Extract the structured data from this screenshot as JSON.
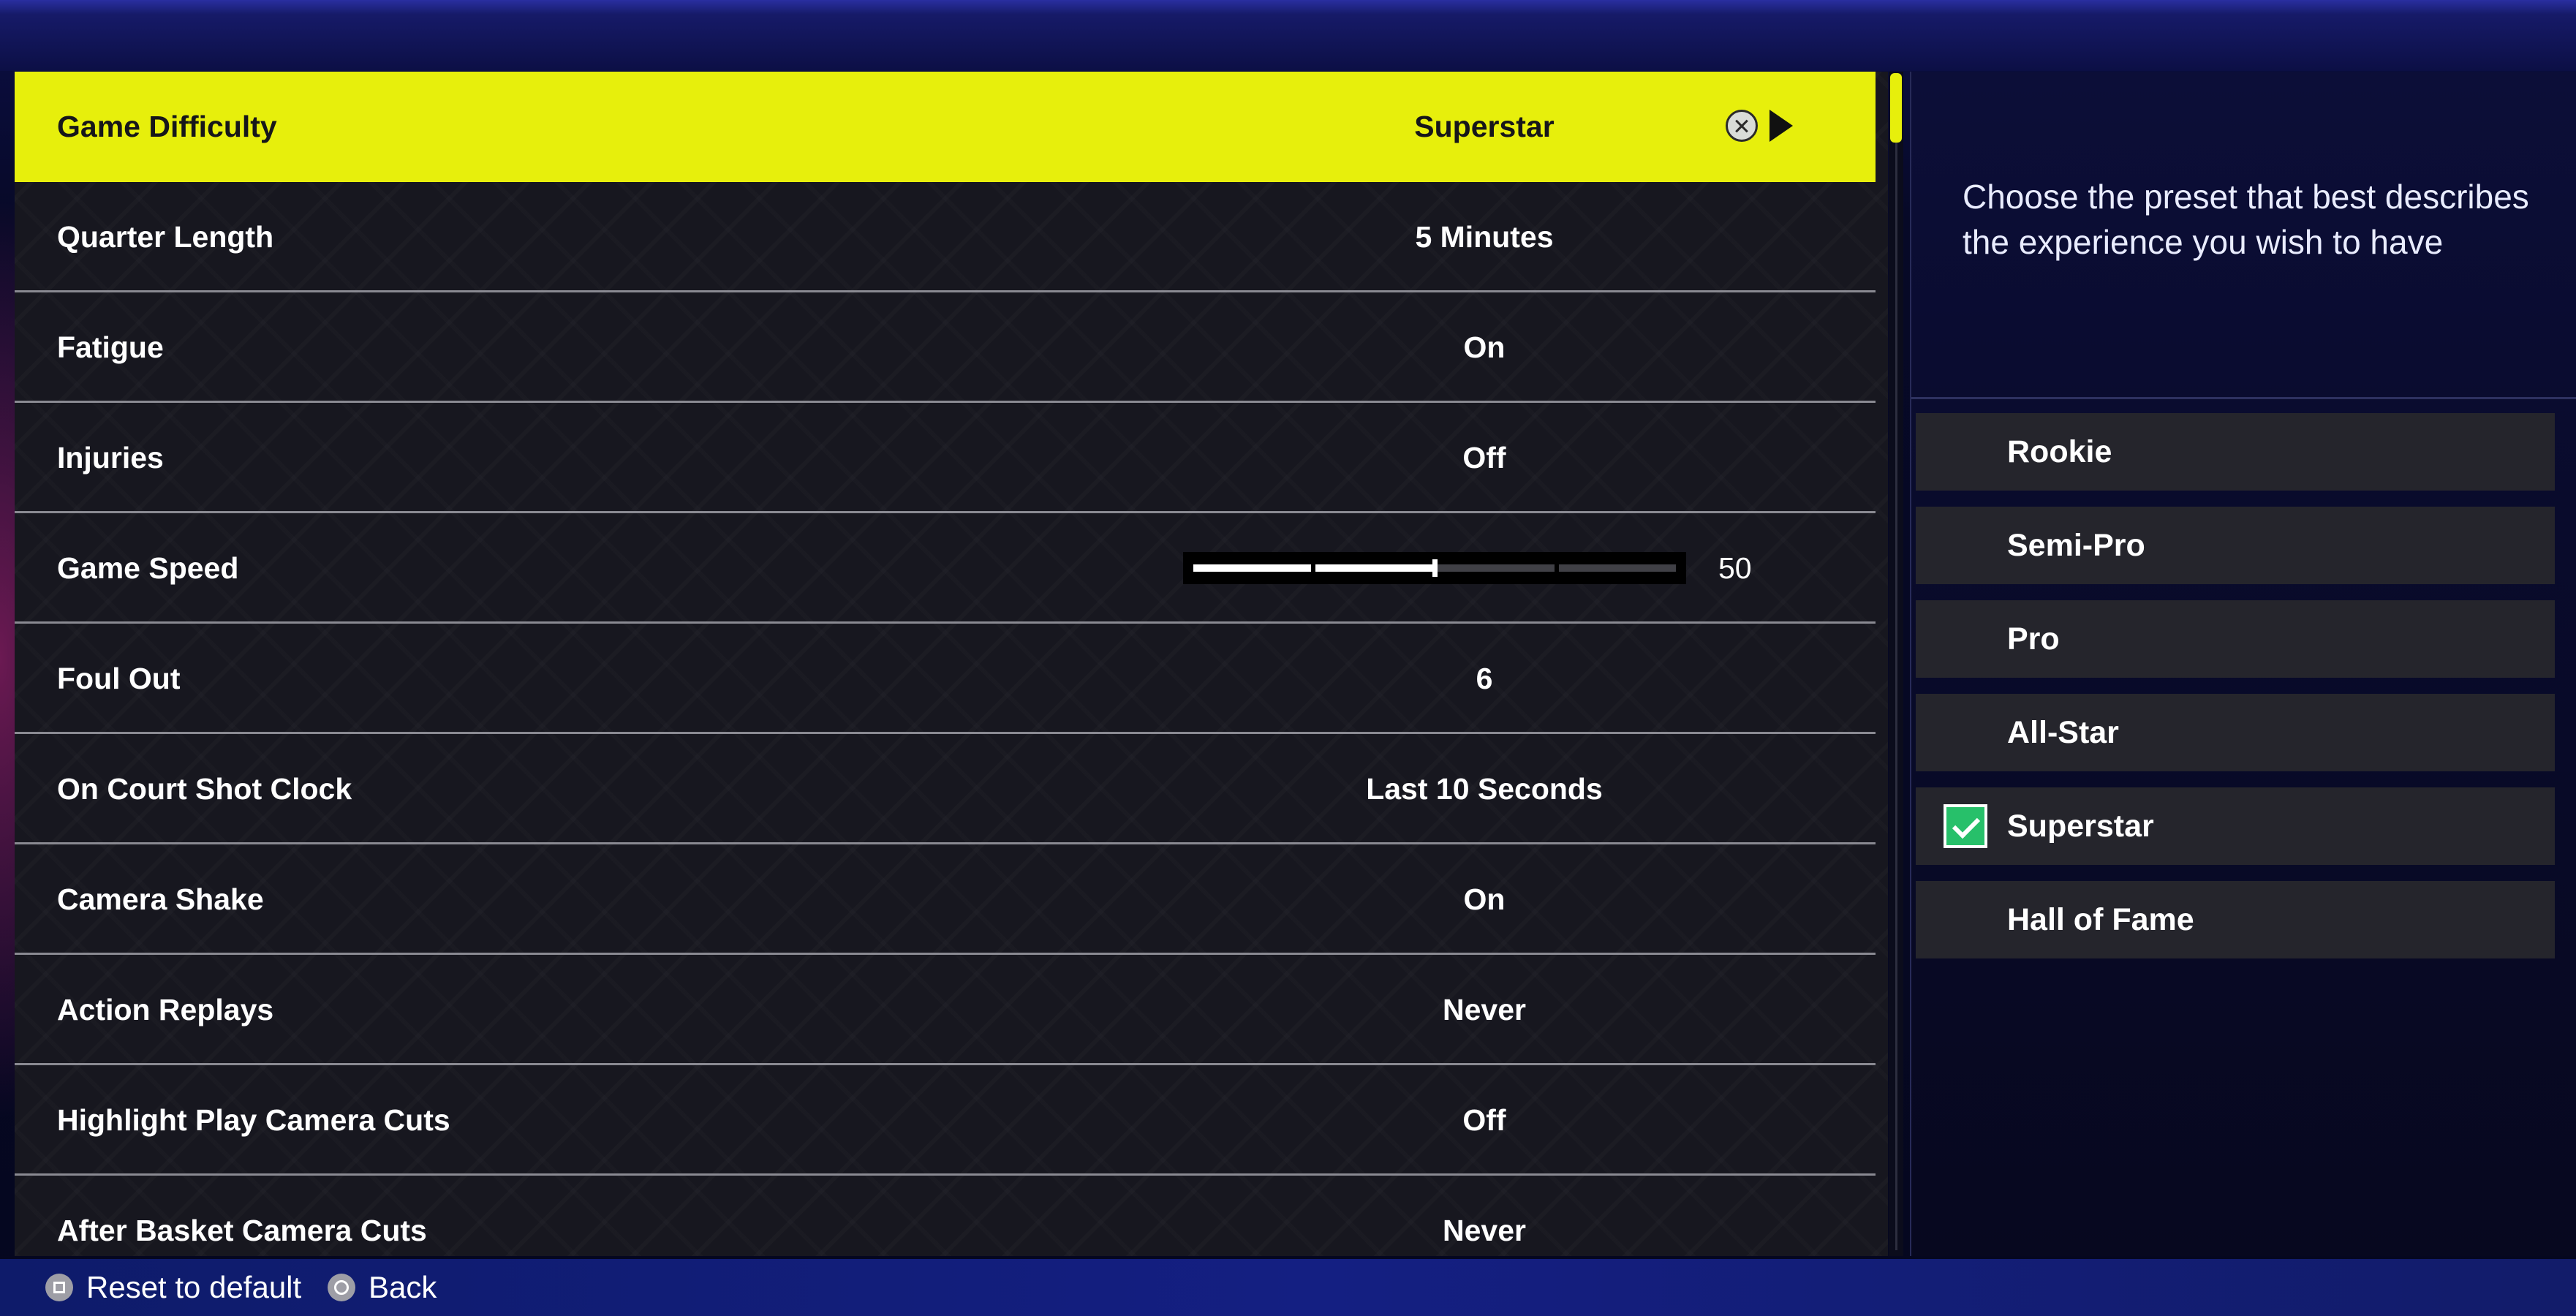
{
  "settings": [
    {
      "label": "Game Difficulty",
      "value": "Superstar"
    },
    {
      "label": "Quarter Length",
      "value": "5 Minutes"
    },
    {
      "label": "Fatigue",
      "value": "On"
    },
    {
      "label": "Injuries",
      "value": "Off"
    },
    {
      "label": "Game Speed",
      "value": "50"
    },
    {
      "label": "Foul Out",
      "value": "6"
    },
    {
      "label": "On Court Shot Clock",
      "value": "Last 10 Seconds"
    },
    {
      "label": "Camera Shake",
      "value": "On"
    },
    {
      "label": "Action Replays",
      "value": "Never"
    },
    {
      "label": "Highlight Play Camera Cuts",
      "value": "Off"
    },
    {
      "label": "After Basket Camera Cuts",
      "value": "Never"
    }
  ],
  "game_speed_slider": {
    "value": 50,
    "min": 0,
    "max": 100
  },
  "selected_setting": "Game Difficulty",
  "description": "Choose the preset that best describes the experience you wish to have",
  "presets": [
    {
      "label": "Rookie",
      "checked": false
    },
    {
      "label": "Semi-Pro",
      "checked": false
    },
    {
      "label": "Pro",
      "checked": false
    },
    {
      "label": "All-Star",
      "checked": false
    },
    {
      "label": "Superstar",
      "checked": true
    },
    {
      "label": "Hall of Fame",
      "checked": false
    }
  ],
  "footer": {
    "reset_label": "Reset to default",
    "back_label": "Back"
  },
  "colors": {
    "highlight": "#e7ef0c",
    "check": "#27c06a",
    "row_background": "#17171f",
    "footer_bar": "#141f82"
  },
  "icons": {
    "selected_row": [
      "x-circle-icon",
      "play-arrow-icon"
    ],
    "checked_preset": "checkmark-icon",
    "reset": "square-button-icon",
    "back": "circle-button-icon"
  }
}
